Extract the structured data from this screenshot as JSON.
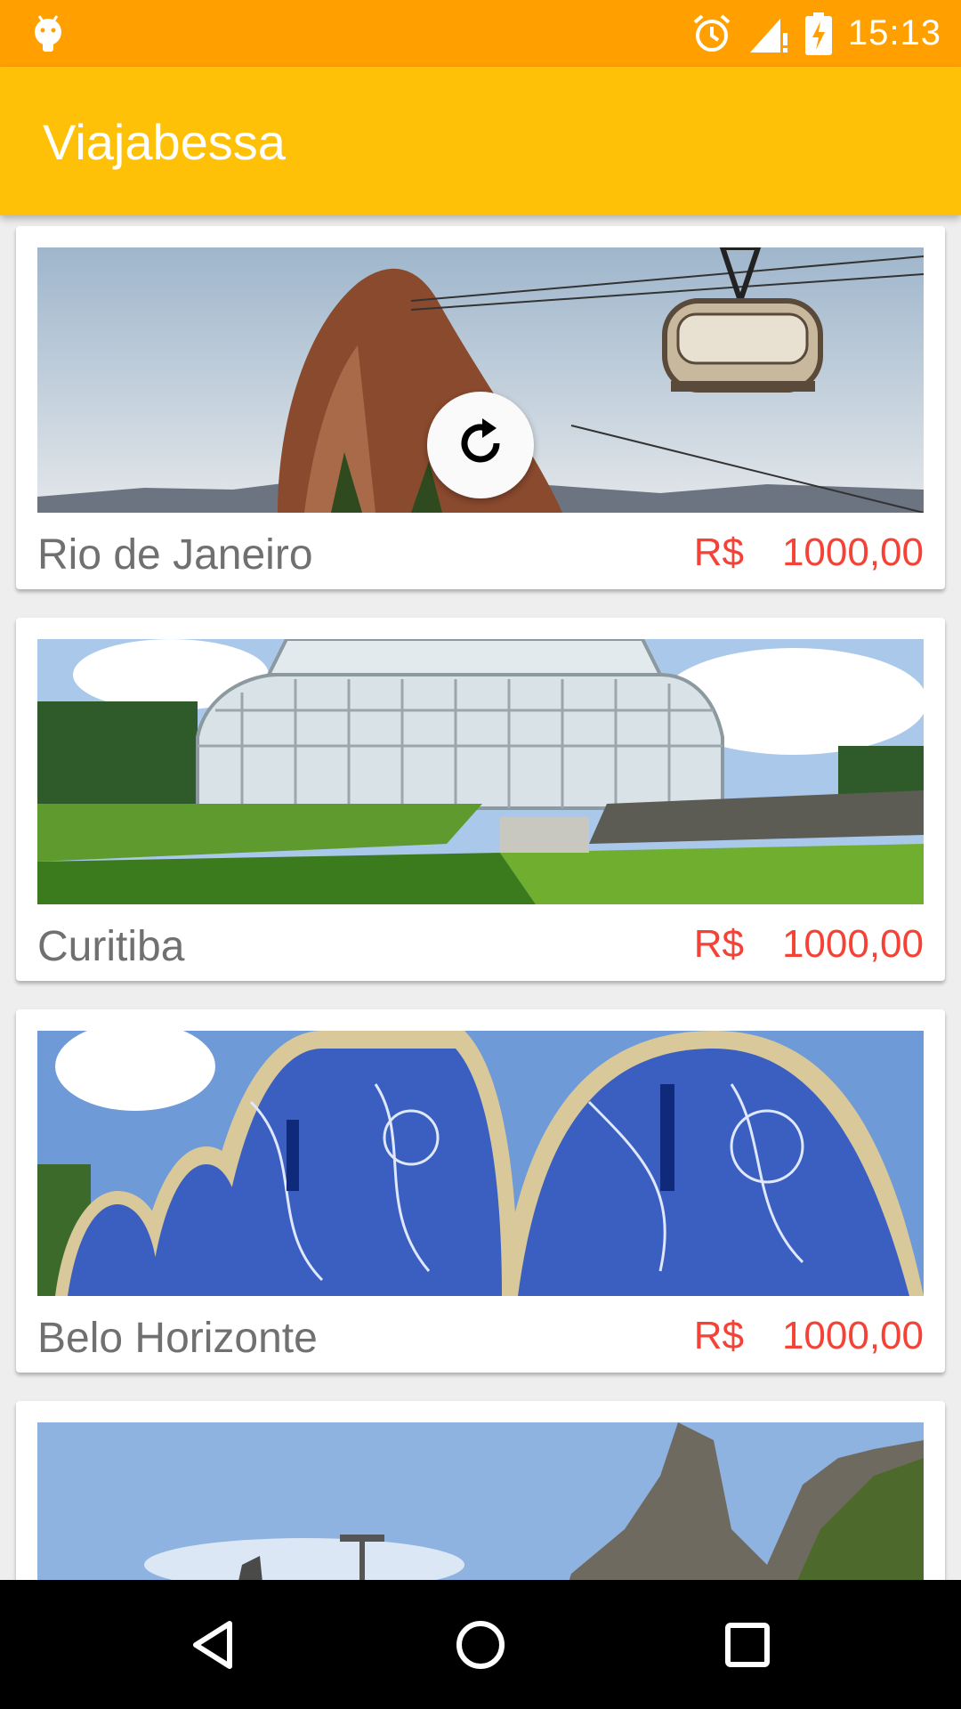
{
  "status_bar": {
    "time": "15:13",
    "icons": [
      "android-debug-icon",
      "alarm-icon",
      "signal-icon",
      "battery-charging-icon"
    ],
    "color": "#FFA000"
  },
  "app_bar": {
    "title": "Viajabessa",
    "color": "#FFC107"
  },
  "trips": [
    {
      "name": "Rio de Janeiro",
      "currency": "R$",
      "price": "1000,00",
      "image": "sugarloaf-mountain-cable-car"
    },
    {
      "name": "Curitiba",
      "currency": "R$",
      "price": "1000,00",
      "image": "botanical-garden-greenhouse"
    },
    {
      "name": "Belo Horizonte",
      "currency": "R$",
      "price": "1000,00",
      "image": "pampulha-church-tiles"
    },
    {
      "name": "",
      "currency": "",
      "price": "",
      "image": "mountain-peaks"
    }
  ],
  "price_color": "#F44336",
  "refresh_indicator": {
    "icon": "refresh-icon"
  },
  "nav_bar": {
    "icons": [
      "back-icon",
      "home-icon",
      "recents-icon"
    ]
  }
}
